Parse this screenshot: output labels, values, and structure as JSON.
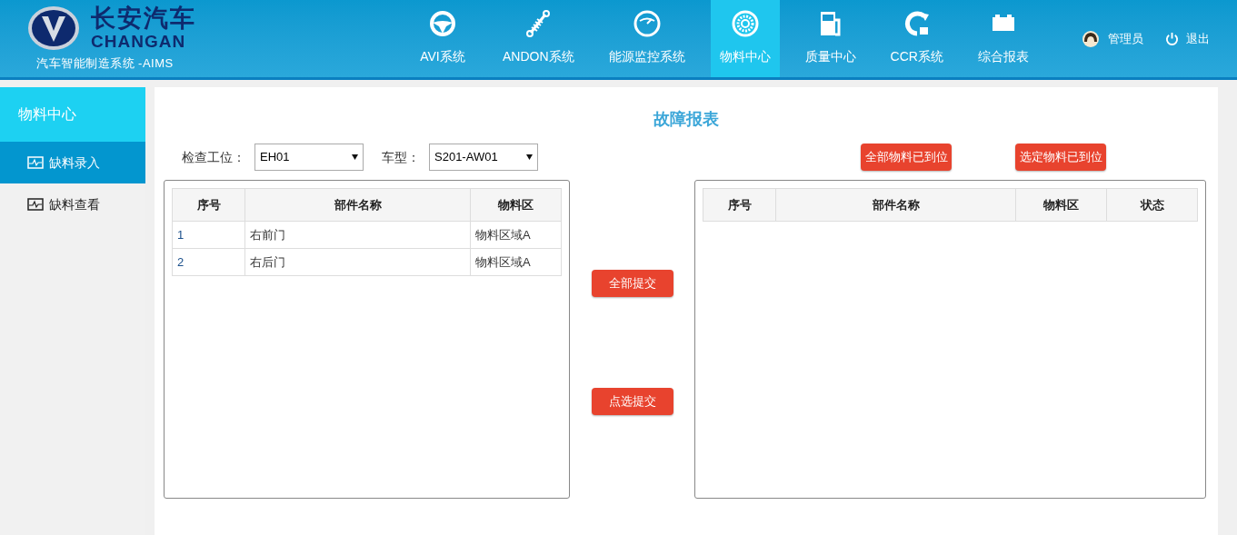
{
  "header": {
    "logo_cn": "长安汽车",
    "logo_en": "CHANGAN",
    "subtitle": "汽车智能制造系统 -AIMS",
    "nav": [
      {
        "label": "AVI系统",
        "selected": false
      },
      {
        "label": "ANDON系统",
        "selected": false
      },
      {
        "label": "能源监控系统",
        "selected": false
      },
      {
        "label": "物料中心",
        "selected": true
      },
      {
        "label": "质量中心",
        "selected": false
      },
      {
        "label": "CCR系统",
        "selected": false
      },
      {
        "label": "综合报表",
        "selected": false
      }
    ],
    "user": "管理员",
    "logout": "退出"
  },
  "sidebar": {
    "title": "物料中心",
    "items": [
      {
        "label": "缺料录入",
        "selected": true
      },
      {
        "label": "缺料查看",
        "selected": false
      }
    ]
  },
  "main": {
    "title": "故障报表",
    "filters": [
      {
        "label": "检查工位：",
        "value": "EH01"
      },
      {
        "label": "车型：",
        "value": "S201-AW01"
      }
    ],
    "top_buttons": [
      "全部物料已到位",
      "选定物料已到位"
    ],
    "left_table": {
      "columns": [
        "序号",
        "部件名称",
        "物料区"
      ],
      "rows": [
        [
          "1",
          "右前门",
          "物料区域A"
        ],
        [
          "2",
          "右后门",
          "物料区域A"
        ]
      ]
    },
    "middle_buttons": [
      "全部提交",
      "点选提交"
    ],
    "right_table": {
      "columns": [
        "序号",
        "部件名称",
        "物料区",
        "状态"
      ]
    }
  }
}
